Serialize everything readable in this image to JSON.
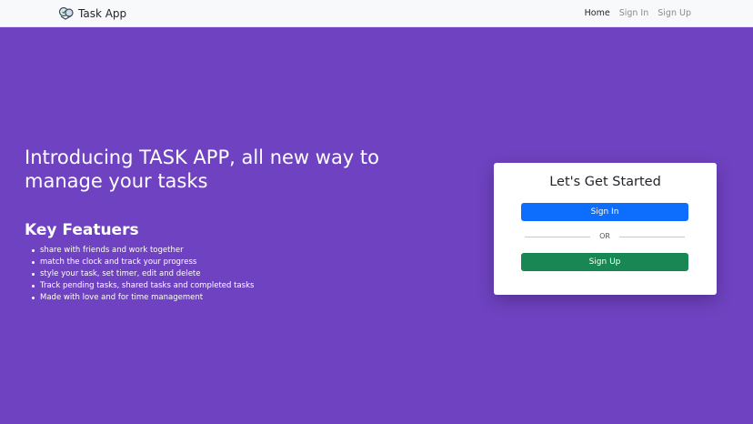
{
  "navbar": {
    "brand": "Task App",
    "links": [
      {
        "label": "Home",
        "active": true
      },
      {
        "label": "Sign In",
        "active": false
      },
      {
        "label": "Sign Up",
        "active": false
      }
    ]
  },
  "hero": {
    "title": "Introducing TASK APP, all new way to manage your tasks",
    "features_title": "Key Featuers",
    "features": [
      "share with friends and work together",
      "match the clock and track your progress",
      "style your task, set timer, edit and delete",
      "Track pending tasks, shared tasks and completed tasks",
      "Made with love and for time management"
    ]
  },
  "card": {
    "title": "Let's Get Started",
    "signin_label": "Sign In",
    "divider_text": "OR",
    "signup_label": "Sign Up"
  },
  "colors": {
    "background": "#6f42c1",
    "navbar": "#f8f9fa",
    "primary": "#0d6efd",
    "success": "#198754"
  },
  "icons": {
    "brand": "task-app-logo-icon"
  }
}
